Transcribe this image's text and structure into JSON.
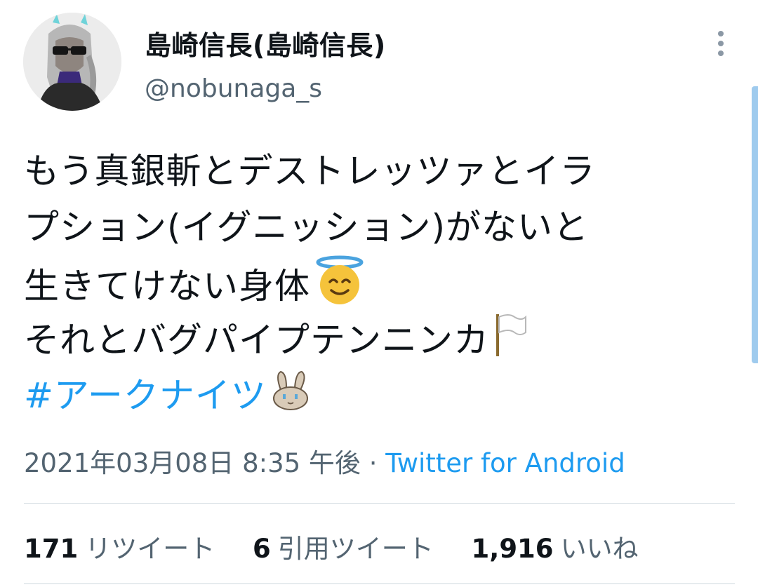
{
  "author": {
    "display_name": "島崎信長(島崎信長)",
    "handle": "@nobunaga_s",
    "avatar_icon": "profile-avatar"
  },
  "tweet": {
    "lines": [
      "もう真銀斬とデストレッツァとイラ",
      "プション(イグニッション)がないと",
      "生きてけない身体",
      "それとバグパイプテンニンカ"
    ],
    "hashtag": "#アークナイツ",
    "emojis": [
      "smiling-face-with-halo",
      "white-flag",
      "bunny-sticker"
    ]
  },
  "meta": {
    "timestamp": "2021年03月08日 8:35 午後",
    "separator": "·",
    "source": "Twitter for Android"
  },
  "stats": {
    "retweets": {
      "count": "171",
      "label": "リツイート"
    },
    "quotes": {
      "count": "6",
      "label": "引用ツイート"
    },
    "likes": {
      "count": "1,916",
      "label": "いいね"
    }
  },
  "colors": {
    "accent": "#1d9bf0",
    "secondary_text": "#536471",
    "primary_text": "#0f1419",
    "divider": "#cfd9de"
  }
}
